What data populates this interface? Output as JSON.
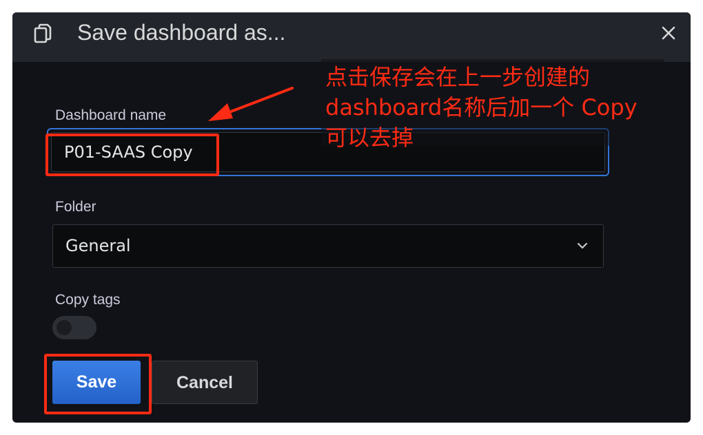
{
  "dialog": {
    "title": "Save dashboard as...",
    "name_label": "Dashboard name",
    "name_value": "P01-SAAS Copy",
    "folder_label": "Folder",
    "folder_value": "General",
    "tags_label": "Copy tags",
    "copy_tags": false,
    "save_label": "Save",
    "cancel_label": "Cancel"
  },
  "annotation": {
    "lines": [
      "点击保存会在上一步创建的",
      "dashboard名称后加一个 Copy",
      "可以去掉"
    ]
  },
  "icons": {
    "header": "copy-icon",
    "close": "close-icon",
    "folder": "chevron-down-icon"
  },
  "colors": {
    "annotation": "#ff2b14",
    "primary": "#3274d9",
    "background": "#111217"
  }
}
